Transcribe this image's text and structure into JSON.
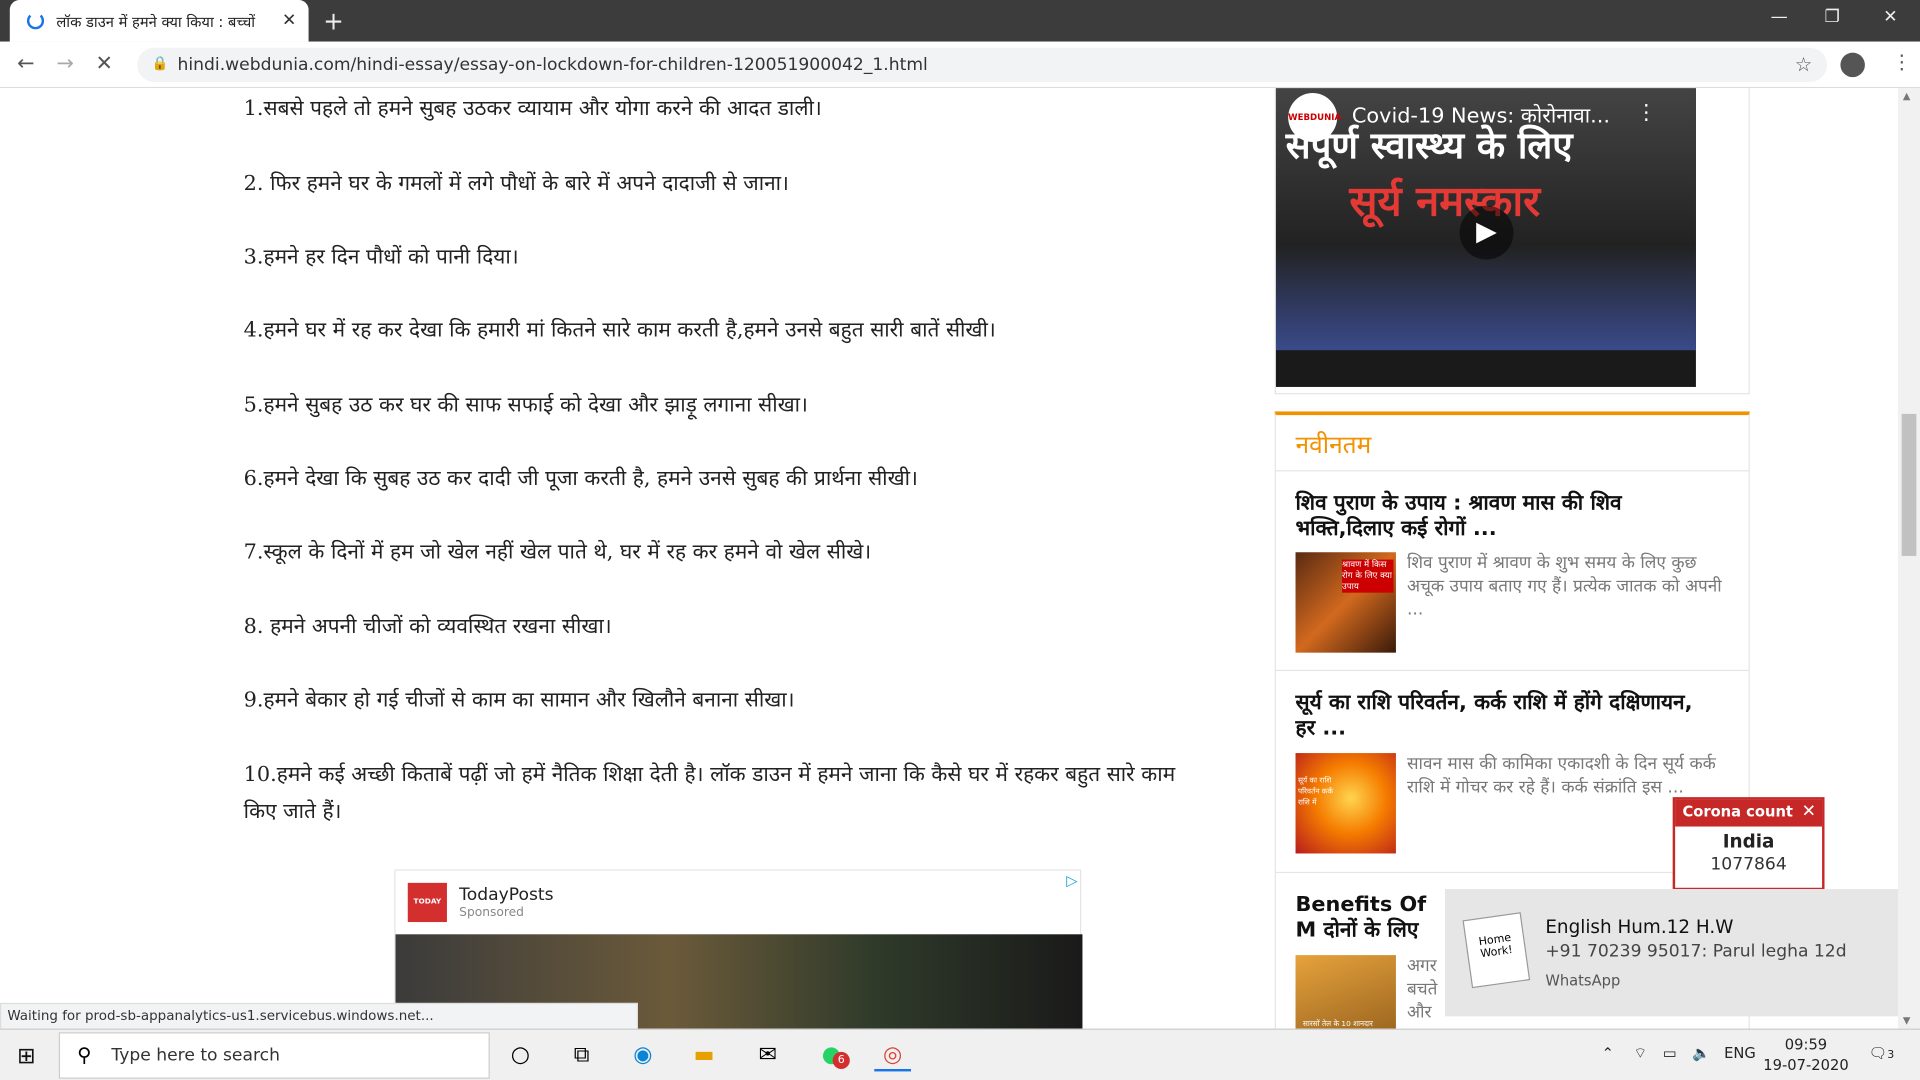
{
  "browser": {
    "tab_title": "लॉक डाउन में हमने क्या किया : बच्चों",
    "url": "hindi.webdunia.com/hindi-essay/essay-on-lockdown-for-children-120051900042_1.html",
    "status_text": "Waiting for prod-sb-appanalytics-us1.servicebus.windows.net..."
  },
  "article": {
    "points": [
      "1.सबसे पहले तो हमने सुबह उठकर व्यायाम और योगा करने की आदत डाली।",
      "2. फिर हमने घर के गमलों में लगे पौधों के बारे में अपने दादाजी से जाना।",
      "3.हमने हर दिन पौधों को पानी दिया।",
      "4.हमने घर में रह कर देखा कि हमारी मां कितने सारे काम करती है,हमने उनसे बहुत सारी बातें सीखी।",
      "5.हमने सुबह उठ कर घर की साफ सफाई को देखा और झाड़ू लगाना सीखा।",
      "6.हमने देखा कि सुबह उठ कर दादी जी पूजा करती है, हमने उनसे सुबह की प्रार्थना सीखी।",
      "7.स्कूल के दिनों में हम जो खेल नहीं खेल पाते थे, घर में रह कर हमने वो खेल सीखे।",
      "8. हमने अपनी चीजों को व्यवस्थित रखना सीखा।",
      "9.हमने बेकार हो गई चीजों से काम का सामान और खिलौने बनाना सीखा।",
      "10.हमने कई अच्छी किताबें पढ़ीं जो हमें नैतिक शिक्षा देती है। लॉक डाउन में हमने जाना कि कैसे घर में रहकर बहुत सारे काम",
      "किए जाते हैं।"
    ]
  },
  "video": {
    "title": "Covid-19 News: कोरोनावा...",
    "logo": "WEBDUNIA",
    "overlay1": "संपूर्ण स्वास्थ्य के लिए",
    "overlay2": "सूर्य नमस्कार"
  },
  "latest": {
    "heading": "नवीनतम",
    "items": [
      {
        "title": "शिव पुराण के उपाय : श्रावण मास की शिव भक्ति,दिलाए कई रोगों ...",
        "text": "शिव पुराण में श्रावण के शुभ समय के लिए कुछ अचूक उपाय बताए गए हैं। प्रत्येक जातक को अपनी ...",
        "img_label": "श्रावण में किस रोग के लिए क्या उपाय"
      },
      {
        "title": "सूर्य का राशि परिवर्तन, कर्क राशि में होंगे दक्षिणायन, हर ...",
        "text": "सावन मास की कामिका एकादशी के दिन सूर्य कर्क राशि में गोचर कर रहे हैं। कर्क संक्रांति इस ...",
        "img_label": "सूर्य का राशि परिवर्तन कर्क राशि में"
      },
      {
        "title": "Benefits Of M दोनों के लिए ...",
        "text": "अगर बचते और ...",
        "img_label": "सारसों तेल के 10 शानदार फायदे, जरूर जानें"
      }
    ]
  },
  "ad": {
    "name": "TodayPosts",
    "sponsored": "Sponsored",
    "logo": "TODAY"
  },
  "corona": {
    "title": "Corona count",
    "country": "India",
    "count": "1077864"
  },
  "toast": {
    "title": "English Hum.12 H.W",
    "message": "+91 70239 95017: Parul legha 12d",
    "app": "WhatsApp",
    "icon_text": "Home Work!"
  },
  "taskbar": {
    "search_placeholder": "Type here to search",
    "whatsapp_badge": "6",
    "language": "ENG",
    "time": "09:59",
    "date": "19-07-2020",
    "notif_count": "3"
  }
}
